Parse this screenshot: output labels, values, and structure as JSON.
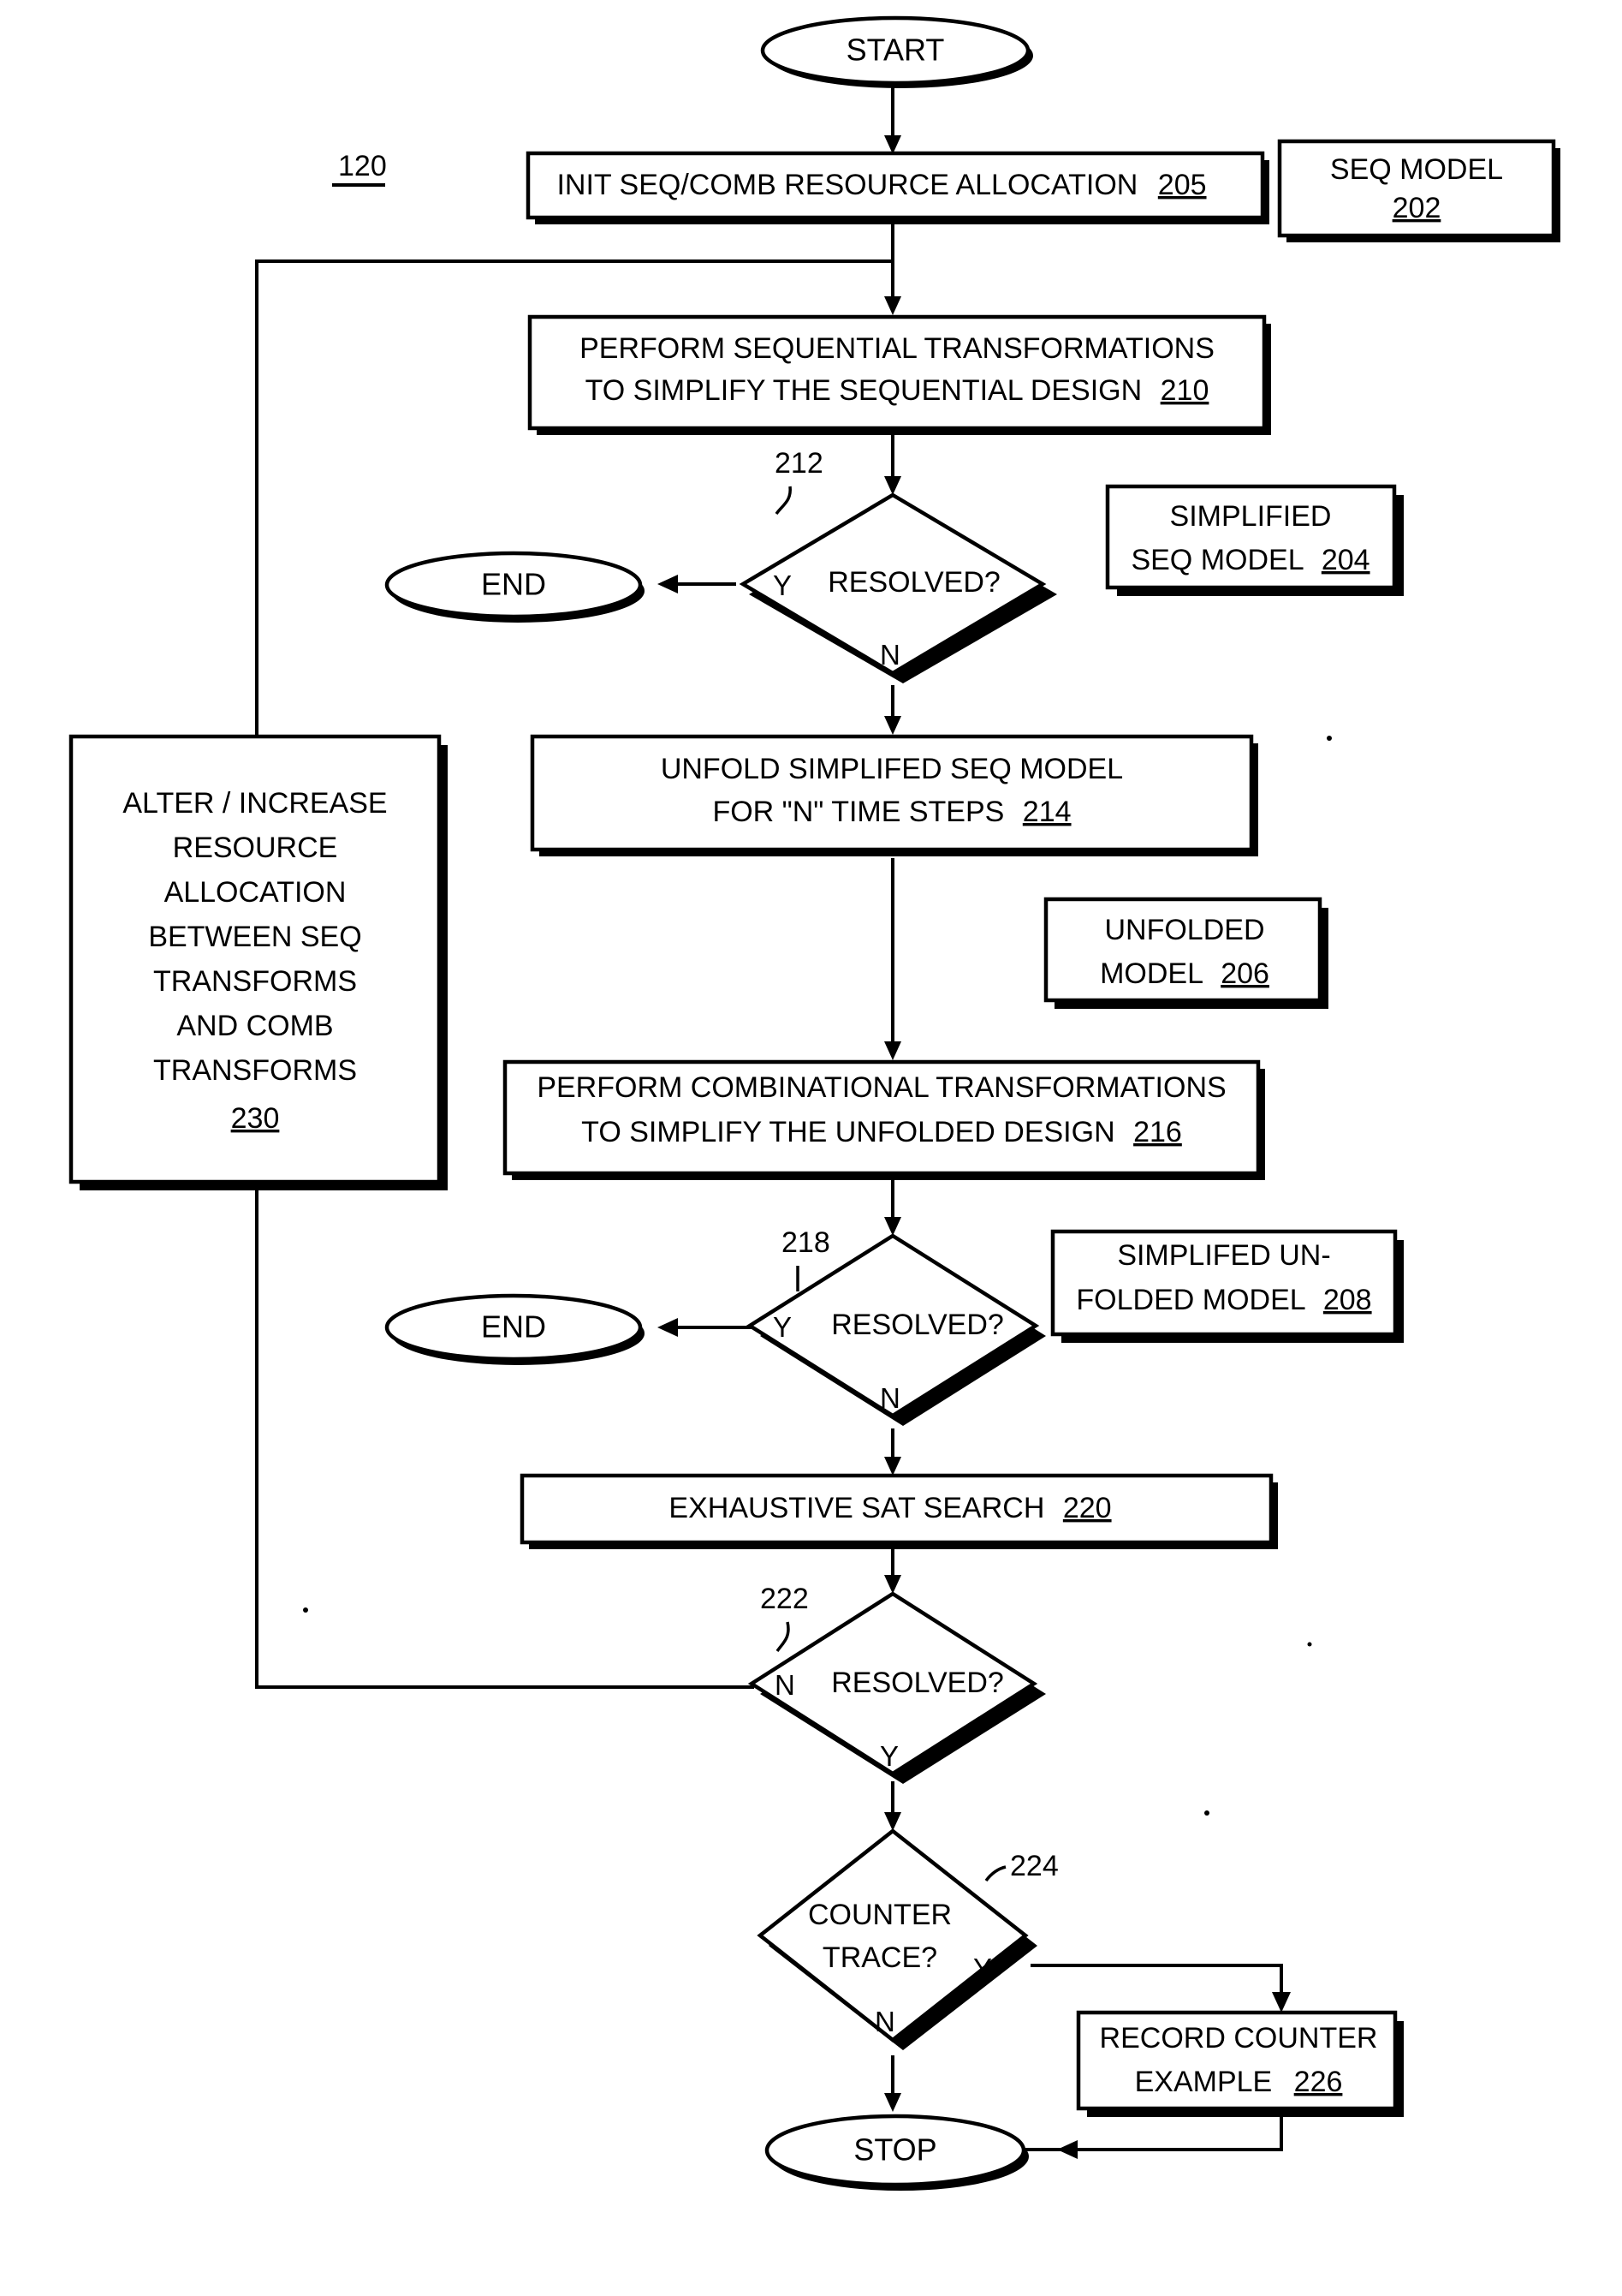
{
  "figure": {
    "label": "120",
    "type": "flowchart"
  },
  "nodes": {
    "start": {
      "label": "START",
      "shape": "terminator"
    },
    "init_alloc": {
      "line1": "INIT SEQ/COMB RESOURCE ALLOCATION",
      "ref": "205",
      "shape": "process"
    },
    "seq_model": {
      "line1": "SEQ MODEL",
      "ref": "202",
      "shape": "data"
    },
    "seq_transform": {
      "line1": "PERFORM SEQUENTIAL TRANSFORMATIONS",
      "line2": "TO SIMPLIFY THE SEQUENTIAL DESIGN",
      "ref": "210",
      "shape": "process"
    },
    "resolved_212": {
      "label": "RESOLVED?",
      "ref": "212",
      "yes": "Y",
      "no": "N",
      "shape": "decision"
    },
    "end_212": {
      "label": "END",
      "shape": "terminator"
    },
    "simplified_seq_model": {
      "line1": "SIMPLIFIED",
      "line2": "SEQ MODEL",
      "ref": "204",
      "shape": "data"
    },
    "unfold": {
      "line1": "UNFOLD SIMPLIFED SEQ MODEL",
      "line2": "FOR \"N\" TIME STEPS",
      "ref": "214",
      "shape": "process"
    },
    "unfolded_model": {
      "line1": "UNFOLDED",
      "line2": "MODEL",
      "ref": "206",
      "shape": "data"
    },
    "comb_transform": {
      "line1": "PERFORM COMBINATIONAL TRANSFORMATIONS",
      "line2": "TO SIMPLIFY THE UNFOLDED DESIGN",
      "ref": "216",
      "shape": "process"
    },
    "resolved_218": {
      "label": "RESOLVED?",
      "ref": "218",
      "yes": "Y",
      "no": "N",
      "shape": "decision"
    },
    "end_218": {
      "label": "END",
      "shape": "terminator"
    },
    "simplified_unfolded_model": {
      "line1": "SIMPLIFED UN-",
      "line2": "FOLDED MODEL",
      "ref": "208",
      "shape": "data"
    },
    "sat_search": {
      "line1": "EXHAUSTIVE SAT SEARCH",
      "ref": "220",
      "shape": "process"
    },
    "resolved_222": {
      "label": "RESOLVED?",
      "ref": "222",
      "yes": "Y",
      "no": "N",
      "shape": "decision"
    },
    "counter_trace": {
      "line1": "COUNTER",
      "line2": "TRACE?",
      "ref": "224",
      "yes": "Y",
      "no": "N",
      "shape": "decision"
    },
    "record_counter": {
      "line1": "RECORD COUNTER",
      "line2": "EXAMPLE",
      "ref": "226",
      "shape": "process"
    },
    "alter_increase": {
      "lines": [
        "ALTER / INCREASE",
        "RESOURCE",
        "ALLOCATION",
        "BETWEEN SEQ",
        "TRANSFORMS",
        "AND COMB",
        "TRANSFORMS"
      ],
      "ref": "230",
      "shape": "process"
    },
    "stop": {
      "label": "STOP",
      "shape": "terminator"
    }
  },
  "colors": {
    "stroke": "#000000",
    "fill": "#ffffff",
    "background": "#ffffff"
  }
}
